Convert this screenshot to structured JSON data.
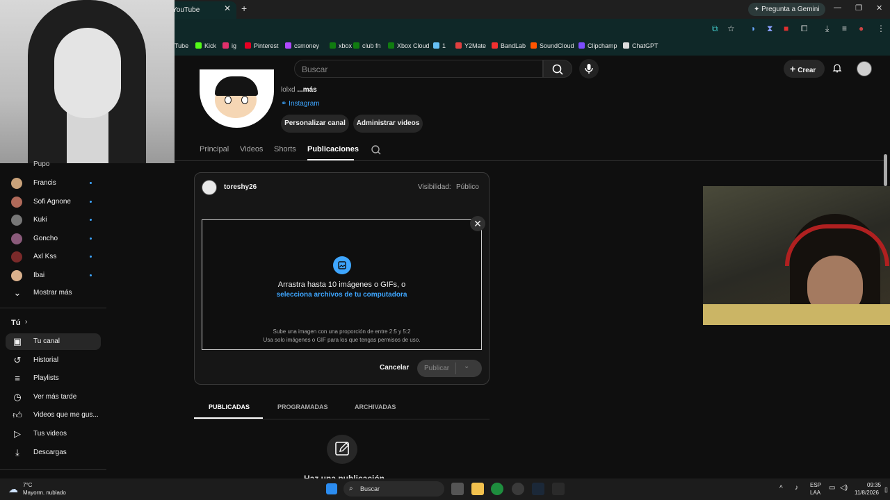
{
  "browser": {
    "tab_title": "YouTube",
    "gemini_label": "Pregunta a Gemini",
    "bookmarks": [
      {
        "label": "Tube",
        "color": "#ff0000"
      },
      {
        "label": "Kick",
        "color": "#53fc18"
      },
      {
        "label": "ig",
        "color": "#e1306c"
      },
      {
        "label": "Pinterest",
        "color": "#e60023"
      },
      {
        "label": "csmoney",
        "color": "#b049ff"
      },
      {
        "label": "xbox",
        "color": "#107c10"
      },
      {
        "label": "club fn",
        "color": "#107c10"
      },
      {
        "label": "Xbox Cloud",
        "color": "#107c10"
      },
      {
        "label": "1",
        "color": "#66c0f4"
      },
      {
        "label": "Y2Mate",
        "color": "#e04040"
      },
      {
        "label": "BandLab",
        "color": "#f03030"
      },
      {
        "label": "SoundCloud",
        "color": "#ff5500"
      },
      {
        "label": "Clipchamp",
        "color": "#7c4dff"
      },
      {
        "label": "ChatGPT",
        "color": "#dddddd"
      }
    ]
  },
  "masthead": {
    "search_placeholder": "Buscar",
    "create_label": "Crear"
  },
  "channel": {
    "handle_prefix": "lolxd",
    "handle_more": "...más",
    "link_label": "Instagram",
    "customize_label": "Personalizar canal",
    "manage_label": "Administrar videos",
    "tabs": [
      "Principal",
      "Videos",
      "Shorts",
      "Publicaciones"
    ]
  },
  "sidebar": {
    "partial_top": "Pupo",
    "subscriptions": [
      {
        "name": "Francis",
        "color": "#c9a27a"
      },
      {
        "name": "Sofi Agnone",
        "color": "#b06a5a"
      },
      {
        "name": "Kuki",
        "color": "#777777"
      },
      {
        "name": "Goncho",
        "color": "#8a5a7a"
      },
      {
        "name": "Axl Kss",
        "color": "#7a2a2a"
      },
      {
        "name": "Ibai",
        "color": "#d9b08c"
      }
    ],
    "show_more": "Mostrar más",
    "you_label": "Tú",
    "you_items": [
      {
        "label": "Tu canal",
        "icon": "channel-icon"
      },
      {
        "label": "Historial",
        "icon": "history-icon"
      },
      {
        "label": "Playlists",
        "icon": "playlists-icon"
      },
      {
        "label": "Ver más tarde",
        "icon": "watch-later-icon"
      },
      {
        "label": "Videos que me gus...",
        "icon": "like-icon"
      },
      {
        "label": "Tus videos",
        "icon": "your-videos-icon"
      },
      {
        "label": "Descargas",
        "icon": "downloads-icon"
      }
    ]
  },
  "post": {
    "username": "toreshy26",
    "visibility_label": "Visibilidad:",
    "visibility_value": "Público",
    "drop_text": "Arrastra hasta 10 imágenes o GIFs, o",
    "drop_link": "selecciona archivos de tu computadora",
    "help_line1": "Sube una imagen con una proporción de entre 2:5 y 5:2",
    "help_line2": "Usa solo imágenes o GIF para los que tengas permisos de uso.",
    "cancel_label": "Cancelar",
    "publish_label": "Publicar"
  },
  "post_tabs": [
    "PUBLICADAS",
    "PROGRAMADAS",
    "ARCHIVADAS"
  ],
  "bottom_partial": "Haz una publicación",
  "taskbar": {
    "temperature": "7°C",
    "weather": "Mayorm. nublado",
    "search_label": "Buscar",
    "lang_top": "ESP",
    "lang_bottom": "LAA",
    "time": "09:35",
    "date": "11/8/2026"
  }
}
